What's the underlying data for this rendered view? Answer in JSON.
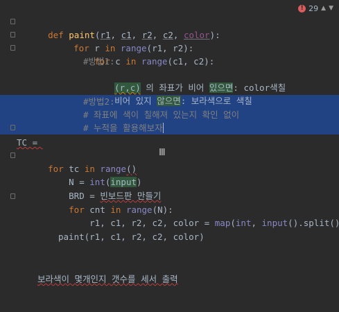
{
  "inspections": {
    "error_count": "29"
  },
  "code": {
    "l1": {
      "def": "def ",
      "name": "paint",
      "open": "(",
      "p1": "r1",
      "c1": ", ",
      "p2": "c1",
      "c2": ", ",
      "p3": "r2",
      "c3": ", ",
      "p4": "c2",
      "c4": ", ",
      "p5": "color",
      "close": "):"
    },
    "l2": {
      "kw_for": "for ",
      "var": "r ",
      "kw_in": "in ",
      "fn": "range",
      "args": "(r1, r2):"
    },
    "l3": {
      "kw_for": "for ",
      "var": "c ",
      "kw_in": "in ",
      "fn": "range",
      "args": "(c1, c2):"
    },
    "l4": "#방법1:",
    "l5": {
      "hl1": "(r,c)",
      "mid": " 의 좌표가 비어 ",
      "hl2": "있으면",
      "rest": ": color색칠"
    },
    "l6": {
      "a": "비어 있지 ",
      "hl": "않으면",
      "b": ": 보라색으로 색칠"
    },
    "l7": "#방법2:",
    "l8": "# 좌표에 색이 칠해져 있는지 확인 없이",
    "l9": "# 누적을 활용해보자",
    "l10": "TC = ",
    "l11": {
      "kw_for": "for ",
      "var": "tc ",
      "kw_in": "in ",
      "fn": "range",
      "args": "()"
    },
    "l12": {
      "pre": "N = ",
      "fn": "int",
      "open": "(",
      "arg": "input",
      "close": ")"
    },
    "l13": {
      "pre": "BRD = ",
      "val": "빈보드판 만들기"
    },
    "l14": {
      "kw_for": "for ",
      "var": "cnt ",
      "kw_in": "in ",
      "fn": "range",
      "args": "(N):"
    },
    "l15": {
      "pre": "r1, c1, r2, c2, color = ",
      "fn1": "map",
      "mid": "(",
      "fn2": "int",
      "mid2": ", ",
      "fn3": "input",
      "rest": "().split())"
    },
    "l17": "paint(r1, c1, r2, c2, color)",
    "l20": "보라색이 몇개인지 갯수를 세서 출력"
  }
}
